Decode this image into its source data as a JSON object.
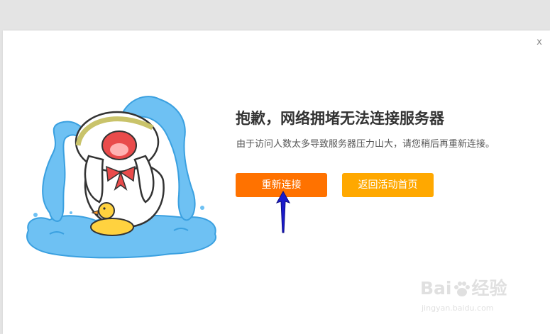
{
  "dialog": {
    "close_label": "x",
    "title": "抱歉，网络拥堵无法连接服务器",
    "subtitle": "由于访问人数太多导致服务器压力山大，请您稍后再重新连接。",
    "reconnect_button": "重新连接",
    "home_button": "返回活动首页",
    "illustration_icon": "crying-cartoon-character-with-duck"
  },
  "annotation": {
    "arrow_icon": "up-arrow-icon",
    "arrow_color": "#1a1acc"
  },
  "watermark": {
    "logo_prefix": "Bai",
    "logo_suffix": "经验",
    "url": "jingyan.baidu.com"
  },
  "colors": {
    "reconnect_button": "#ff7200",
    "home_button": "#ffa800",
    "title_text": "#333333",
    "subtitle_text": "#555555",
    "tears": "#6ec1f3"
  }
}
